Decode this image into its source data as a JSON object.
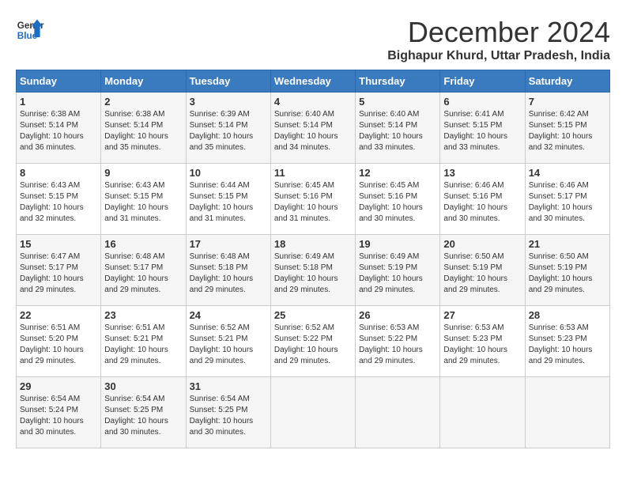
{
  "logo": {
    "line1": "General",
    "line2": "Blue"
  },
  "title": "December 2024",
  "subtitle": "Bighapur Khurd, Uttar Pradesh, India",
  "weekdays": [
    "Sunday",
    "Monday",
    "Tuesday",
    "Wednesday",
    "Thursday",
    "Friday",
    "Saturday"
  ],
  "weeks": [
    [
      {
        "day": "1",
        "sunrise": "6:38 AM",
        "sunset": "5:14 PM",
        "daylight": "10 hours and 36 minutes."
      },
      {
        "day": "2",
        "sunrise": "6:38 AM",
        "sunset": "5:14 PM",
        "daylight": "10 hours and 35 minutes."
      },
      {
        "day": "3",
        "sunrise": "6:39 AM",
        "sunset": "5:14 PM",
        "daylight": "10 hours and 35 minutes."
      },
      {
        "day": "4",
        "sunrise": "6:40 AM",
        "sunset": "5:14 PM",
        "daylight": "10 hours and 34 minutes."
      },
      {
        "day": "5",
        "sunrise": "6:40 AM",
        "sunset": "5:14 PM",
        "daylight": "10 hours and 33 minutes."
      },
      {
        "day": "6",
        "sunrise": "6:41 AM",
        "sunset": "5:15 PM",
        "daylight": "10 hours and 33 minutes."
      },
      {
        "day": "7",
        "sunrise": "6:42 AM",
        "sunset": "5:15 PM",
        "daylight": "10 hours and 32 minutes."
      }
    ],
    [
      {
        "day": "8",
        "sunrise": "6:43 AM",
        "sunset": "5:15 PM",
        "daylight": "10 hours and 32 minutes."
      },
      {
        "day": "9",
        "sunrise": "6:43 AM",
        "sunset": "5:15 PM",
        "daylight": "10 hours and 31 minutes."
      },
      {
        "day": "10",
        "sunrise": "6:44 AM",
        "sunset": "5:15 PM",
        "daylight": "10 hours and 31 minutes."
      },
      {
        "day": "11",
        "sunrise": "6:45 AM",
        "sunset": "5:16 PM",
        "daylight": "10 hours and 31 minutes."
      },
      {
        "day": "12",
        "sunrise": "6:45 AM",
        "sunset": "5:16 PM",
        "daylight": "10 hours and 30 minutes."
      },
      {
        "day": "13",
        "sunrise": "6:46 AM",
        "sunset": "5:16 PM",
        "daylight": "10 hours and 30 minutes."
      },
      {
        "day": "14",
        "sunrise": "6:46 AM",
        "sunset": "5:17 PM",
        "daylight": "10 hours and 30 minutes."
      }
    ],
    [
      {
        "day": "15",
        "sunrise": "6:47 AM",
        "sunset": "5:17 PM",
        "daylight": "10 hours and 29 minutes."
      },
      {
        "day": "16",
        "sunrise": "6:48 AM",
        "sunset": "5:17 PM",
        "daylight": "10 hours and 29 minutes."
      },
      {
        "day": "17",
        "sunrise": "6:48 AM",
        "sunset": "5:18 PM",
        "daylight": "10 hours and 29 minutes."
      },
      {
        "day": "18",
        "sunrise": "6:49 AM",
        "sunset": "5:18 PM",
        "daylight": "10 hours and 29 minutes."
      },
      {
        "day": "19",
        "sunrise": "6:49 AM",
        "sunset": "5:19 PM",
        "daylight": "10 hours and 29 minutes."
      },
      {
        "day": "20",
        "sunrise": "6:50 AM",
        "sunset": "5:19 PM",
        "daylight": "10 hours and 29 minutes."
      },
      {
        "day": "21",
        "sunrise": "6:50 AM",
        "sunset": "5:19 PM",
        "daylight": "10 hours and 29 minutes."
      }
    ],
    [
      {
        "day": "22",
        "sunrise": "6:51 AM",
        "sunset": "5:20 PM",
        "daylight": "10 hours and 29 minutes."
      },
      {
        "day": "23",
        "sunrise": "6:51 AM",
        "sunset": "5:21 PM",
        "daylight": "10 hours and 29 minutes."
      },
      {
        "day": "24",
        "sunrise": "6:52 AM",
        "sunset": "5:21 PM",
        "daylight": "10 hours and 29 minutes."
      },
      {
        "day": "25",
        "sunrise": "6:52 AM",
        "sunset": "5:22 PM",
        "daylight": "10 hours and 29 minutes."
      },
      {
        "day": "26",
        "sunrise": "6:53 AM",
        "sunset": "5:22 PM",
        "daylight": "10 hours and 29 minutes."
      },
      {
        "day": "27",
        "sunrise": "6:53 AM",
        "sunset": "5:23 PM",
        "daylight": "10 hours and 29 minutes."
      },
      {
        "day": "28",
        "sunrise": "6:53 AM",
        "sunset": "5:23 PM",
        "daylight": "10 hours and 29 minutes."
      }
    ],
    [
      {
        "day": "29",
        "sunrise": "6:54 AM",
        "sunset": "5:24 PM",
        "daylight": "10 hours and 30 minutes."
      },
      {
        "day": "30",
        "sunrise": "6:54 AM",
        "sunset": "5:25 PM",
        "daylight": "10 hours and 30 minutes."
      },
      {
        "day": "31",
        "sunrise": "6:54 AM",
        "sunset": "5:25 PM",
        "daylight": "10 hours and 30 minutes."
      },
      null,
      null,
      null,
      null
    ]
  ]
}
